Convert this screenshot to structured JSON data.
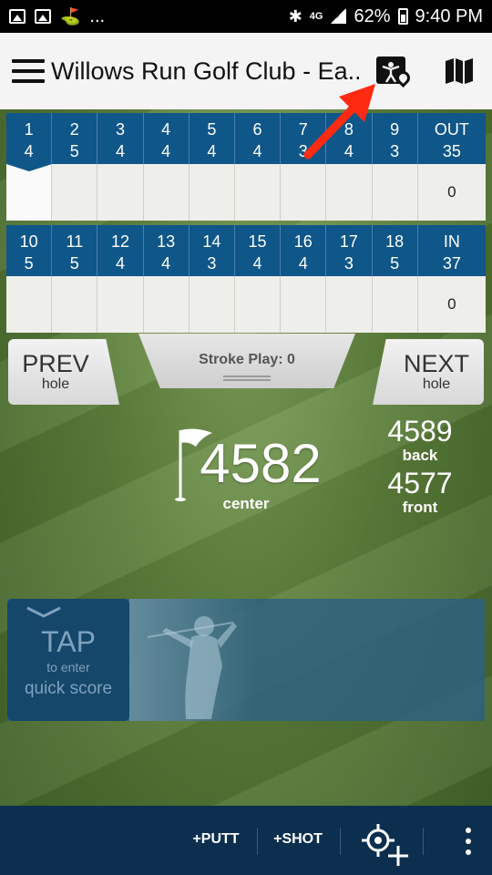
{
  "status_bar": {
    "left_icons": [
      "photo-icon",
      "image-icon",
      "golf-flag-icon"
    ],
    "more": "...",
    "right_icons": [
      "bluetooth-icon",
      "wifi-icon",
      "signal-icon",
      "battery-icon"
    ],
    "network": "4G",
    "battery": "62%",
    "time": "9:40 PM"
  },
  "app_bar": {
    "title": "Willows Run Golf Club - Ea...",
    "icons": [
      "menu-icon",
      "course-pin-icon",
      "map-icon"
    ]
  },
  "front_nine": {
    "holes": [
      "1",
      "2",
      "3",
      "4",
      "5",
      "6",
      "7",
      "8",
      "9",
      "OUT"
    ],
    "pars": [
      "4",
      "5",
      "4",
      "4",
      "4",
      "4",
      "3",
      "4",
      "3",
      "35"
    ],
    "scores": [
      "",
      "",
      "",
      "",
      "",
      "",
      "",
      "",
      "",
      "0"
    ],
    "active_hole": "1"
  },
  "back_nine": {
    "holes": [
      "10",
      "11",
      "12",
      "13",
      "14",
      "15",
      "16",
      "17",
      "18",
      "IN"
    ],
    "pars": [
      "5",
      "5",
      "4",
      "4",
      "3",
      "4",
      "4",
      "3",
      "5",
      "37"
    ],
    "scores": [
      "",
      "",
      "",
      "",
      "",
      "",
      "",
      "",
      "",
      "0"
    ]
  },
  "controls": {
    "prev_main": "PREV",
    "prev_sub": "hole",
    "next_main": "NEXT",
    "next_sub": "hole",
    "stroke_play": "Stroke Play: 0"
  },
  "yardage": {
    "center": "4582",
    "center_label": "center",
    "back": "4589",
    "back_label": "back",
    "front": "4577",
    "front_label": "front"
  },
  "quick_score": {
    "tap": "TAP",
    "to_enter": "to enter",
    "quick_score": "quick score"
  },
  "bottom_bar": {
    "putt": "+PUTT",
    "shot": "+SHOT",
    "icons": [
      "target-add-icon",
      "more-vertical-icon"
    ]
  },
  "colors": {
    "header_blue": "#0f5689",
    "bottom_bar": "#0d2f4f",
    "annotation_arrow": "#ff2a12"
  }
}
